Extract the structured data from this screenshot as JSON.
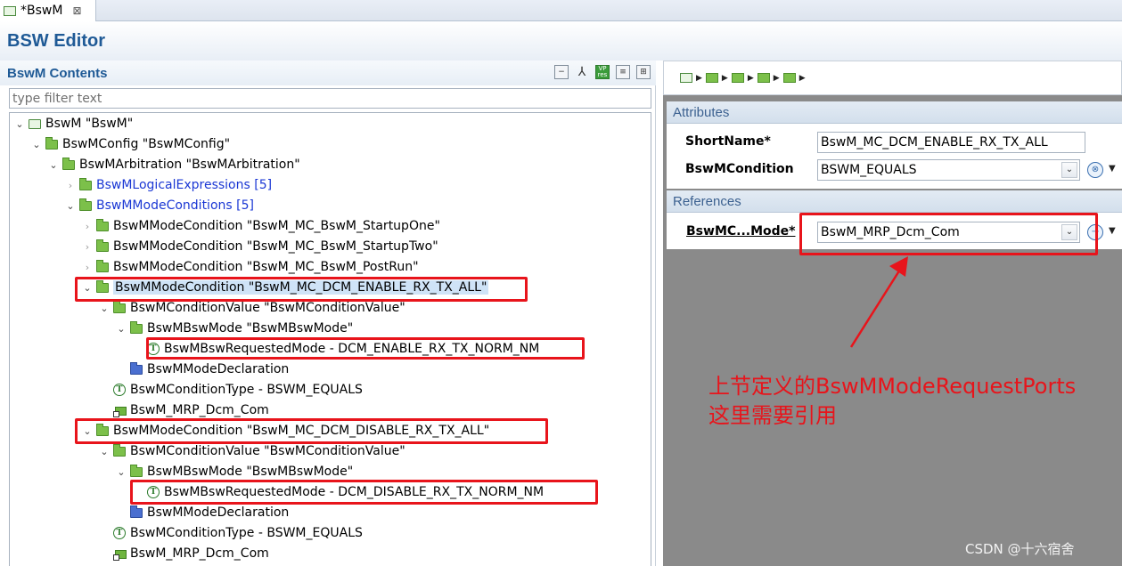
{
  "tab": {
    "label": "*BswM",
    "close": "⊠"
  },
  "editor": {
    "title": "BSW Editor"
  },
  "contents": {
    "title": "BswM Contents",
    "filter_placeholder": "type filter text"
  },
  "tree": [
    {
      "label": "BswM \"BswM\"",
      "depth": 0,
      "twisty": "open",
      "icon": "module"
    },
    {
      "label": "BswMConfig \"BswMConfig\"",
      "depth": 1,
      "twisty": "open",
      "icon": "folder"
    },
    {
      "label": "BswMArbitration \"BswMArbitration\"",
      "depth": 2,
      "twisty": "open",
      "icon": "folder"
    },
    {
      "label": "BswMLogicalExpressions [5]",
      "depth": 3,
      "twisty": "closed",
      "icon": "folder",
      "link": true
    },
    {
      "label": "BswMModeConditions [5]",
      "depth": 3,
      "twisty": "open",
      "icon": "folder",
      "link": true
    },
    {
      "label": "BswMModeCondition \"BswM_MC_BswM_StartupOne\"",
      "depth": 4,
      "twisty": "closed",
      "icon": "folder"
    },
    {
      "label": "BswMModeCondition \"BswM_MC_BswM_StartupTwo\"",
      "depth": 4,
      "twisty": "closed",
      "icon": "folder"
    },
    {
      "label": "BswMModeCondition \"BswM_MC_BswM_PostRun\"",
      "depth": 4,
      "twisty": "closed",
      "icon": "folder"
    },
    {
      "label": "BswMModeCondition \"BswM_MC_DCM_ENABLE_RX_TX_ALL\"",
      "depth": 4,
      "twisty": "open",
      "icon": "folder",
      "selected": true
    },
    {
      "label": "BswMConditionValue \"BswMConditionValue\"",
      "depth": 5,
      "twisty": "open",
      "icon": "folder"
    },
    {
      "label": "BswMBswMode \"BswMBswMode\"",
      "depth": 6,
      "twisty": "open",
      "icon": "folder"
    },
    {
      "label": "BswMBswRequestedMode - DCM_ENABLE_RX_TX_NORM_NM",
      "depth": 7,
      "twisty": "none",
      "icon": "text"
    },
    {
      "label": "BswMModeDeclaration",
      "depth": 6,
      "twisty": "none",
      "icon": "blue"
    },
    {
      "label": "BswMConditionType - BSWM_EQUALS",
      "depth": 5,
      "twisty": "none",
      "icon": "text"
    },
    {
      "label": "BswM_MRP_Dcm_Com",
      "depth": 5,
      "twisty": "none",
      "icon": "ref"
    },
    {
      "label": "BswMModeCondition \"BswM_MC_DCM_DISABLE_RX_TX_ALL\"",
      "depth": 4,
      "twisty": "open",
      "icon": "folder"
    },
    {
      "label": "BswMConditionValue \"BswMConditionValue\"",
      "depth": 5,
      "twisty": "open",
      "icon": "folder"
    },
    {
      "label": "BswMBswMode \"BswMBswMode\"",
      "depth": 6,
      "twisty": "open",
      "icon": "folder"
    },
    {
      "label": "BswMBswRequestedMode - DCM_DISABLE_RX_TX_NORM_NM",
      "depth": 7,
      "twisty": "none",
      "icon": "text"
    },
    {
      "label": "BswMModeDeclaration",
      "depth": 6,
      "twisty": "none",
      "icon": "blue"
    },
    {
      "label": "BswMConditionType - BSWM_EQUALS",
      "depth": 5,
      "twisty": "none",
      "icon": "text"
    },
    {
      "label": "BswM_MRP_Dcm_Com",
      "depth": 5,
      "twisty": "none",
      "icon": "ref"
    }
  ],
  "attributes": {
    "title": "Attributes",
    "shortname_label": "ShortName*",
    "shortname_value": "BswM_MC_DCM_ENABLE_RX_TX_ALL",
    "condition_label": "BswMCondition",
    "condition_value": "BSWM_EQUALS"
  },
  "references": {
    "title": "References",
    "mode_label": "BswMC...Mode*",
    "mode_value": "BswM_MRP_Dcm_Com"
  },
  "annotation": {
    "line1": "上节定义的BswMModeRequestPorts",
    "line2": "这里需要引用"
  },
  "watermark": "CSDN @十六宿舍",
  "colors": {
    "accent": "#1f5a96",
    "highlight": "#e8141b",
    "link": "#1a37d4"
  }
}
